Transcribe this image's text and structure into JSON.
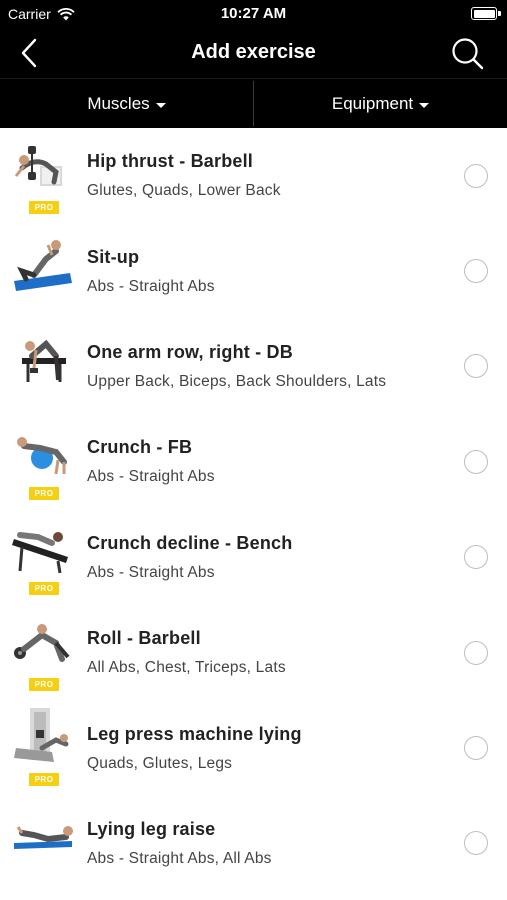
{
  "status": {
    "carrier": "Carrier",
    "time": "10:27 AM"
  },
  "nav": {
    "title": "Add exercise",
    "back_icon": "chevron-left-icon",
    "search_icon": "search-icon"
  },
  "filters": {
    "muscles": "Muscles",
    "equipment": "Equipment"
  },
  "badge": "PRO",
  "exercises": [
    {
      "name": "Hip thrust - Barbell",
      "muscles": "Glutes, Quads, Lower Back",
      "pro": true
    },
    {
      "name": "Sit-up",
      "muscles": "Abs - Straight Abs",
      "pro": false
    },
    {
      "name": "One arm row, right - DB",
      "muscles": "Upper Back, Biceps, Back Shoulders, Lats",
      "pro": false
    },
    {
      "name": "Crunch - FB",
      "muscles": "Abs - Straight Abs",
      "pro": true
    },
    {
      "name": "Crunch decline - Bench",
      "muscles": "Abs - Straight Abs",
      "pro": true
    },
    {
      "name": "Roll - Barbell",
      "muscles": "All Abs, Chest, Triceps, Lats",
      "pro": true
    },
    {
      "name": "Leg press machine lying",
      "muscles": "Quads, Glutes, Legs",
      "pro": true
    },
    {
      "name": "Lying leg raise",
      "muscles": "Abs - Straight Abs, All Abs",
      "pro": false
    }
  ]
}
